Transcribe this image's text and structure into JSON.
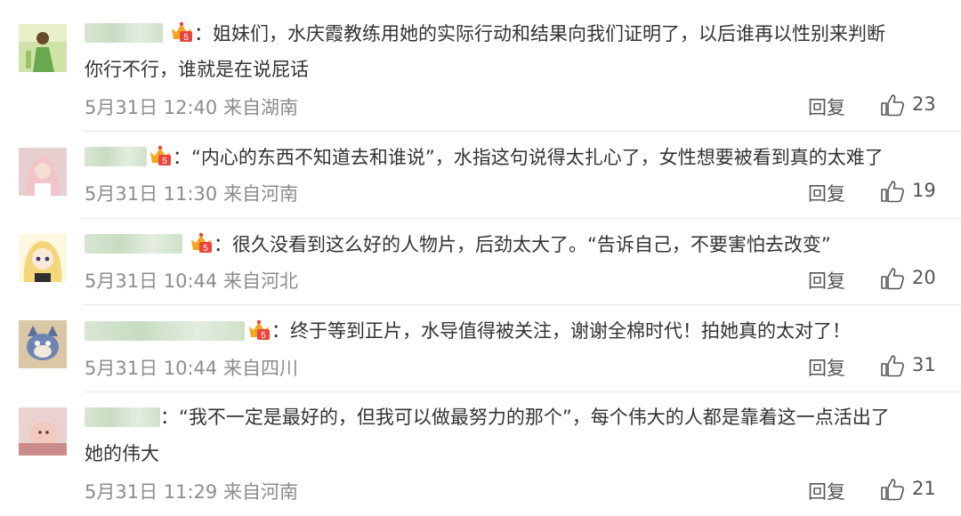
{
  "comments": [
    {
      "text_line1": "：姐妹们，水庆霞教练用她的实际行动和结果向我们证明了，以后谁再以性别来判断",
      "text_line2": "你行不行，谁就是在说屁话",
      "date": "5月31日 12:40 来自湖南",
      "reply_label": "回复",
      "likes": "23",
      "avatar_icon": "avatar-green-figure",
      "has_badge": true
    },
    {
      "text_line1": "：“内心的东西不知道去和谁说”，水指这句说得太扎心了，女性想要被看到真的太难了",
      "text_line2": "",
      "date": "5月31日 11:30 来自河南",
      "reply_label": "回复",
      "likes": "19",
      "avatar_icon": "avatar-pink-girl",
      "has_badge": true
    },
    {
      "text_line1": "：很久没看到这么好的人物片，后劲太大了。“告诉自己，不要害怕去改变”",
      "text_line2": "",
      "date": "5月31日 10:44 来自河北",
      "reply_label": "回复",
      "likes": "20",
      "avatar_icon": "avatar-anime-blonde",
      "has_badge": true
    },
    {
      "text_line1": "：终于等到正片，水导值得被关注，谢谢全棉时代！拍她真的太对了！",
      "text_line2": "",
      "date": "5月31日 10:44 来自四川",
      "reply_label": "回复",
      "likes": "31",
      "avatar_icon": "avatar-cartoon-cat",
      "has_badge": true
    },
    {
      "text_line1": "：“我不一定是最好的，但我可以做最努力的那个”，每个伟大的人都是靠着这一点活出了",
      "text_line2": "她的伟大",
      "date": "5月31日 11:29 来自河南",
      "reply_label": "回复",
      "likes": "21",
      "avatar_icon": "avatar-baby-photo",
      "has_badge": false
    }
  ],
  "colors": {
    "text": "#333333",
    "meta": "#8c8c8c",
    "divider": "#e6e6e6",
    "badge_orange": "#f5a623",
    "badge_red": "#e8453c"
  },
  "icons": {
    "like": "thumbs-up-icon",
    "badge": "vip-crown-badge-icon"
  }
}
